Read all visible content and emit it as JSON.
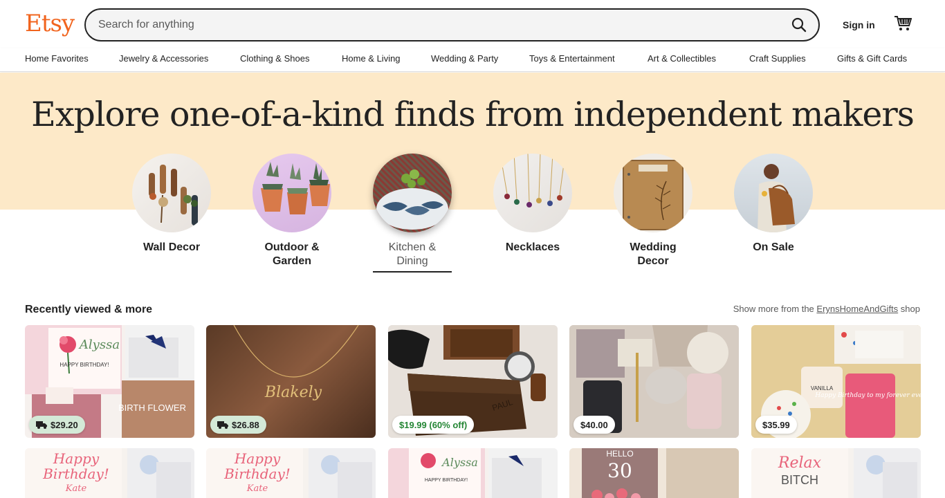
{
  "header": {
    "logo": "Etsy",
    "search_placeholder": "Search for anything",
    "sign_in": "Sign in"
  },
  "nav": {
    "items": [
      "Home Favorites",
      "Jewelry & Accessories",
      "Clothing & Shoes",
      "Home & Living",
      "Wedding & Party",
      "Toys & Entertainment",
      "Art & Collectibles",
      "Craft Supplies",
      "Gifts & Gift Cards"
    ]
  },
  "hero": {
    "title": "Explore one-of-a-kind finds from independent makers"
  },
  "categories": [
    {
      "line1": "Wall Decor",
      "line2": ""
    },
    {
      "line1": "Outdoor &",
      "line2": "Garden"
    },
    {
      "line1": "Kitchen &",
      "line2": "Dining"
    },
    {
      "line1": "Necklaces",
      "line2": ""
    },
    {
      "line1": "Wedding",
      "line2": "Decor"
    },
    {
      "line1": "On Sale",
      "line2": ""
    }
  ],
  "recent": {
    "title": "Recently viewed & more",
    "shop_prefix": "Show more from the",
    "shop_name": "ErynsHomeAndGifts",
    "shop_suffix": "shop",
    "items": [
      {
        "price": "$29.20",
        "free_shipping": true,
        "sale": false
      },
      {
        "price": "$26.88",
        "free_shipping": true,
        "sale": false
      },
      {
        "price": "$19.99 (60% off)",
        "free_shipping": false,
        "sale": true
      },
      {
        "price": "$40.00",
        "free_shipping": false,
        "sale": false
      },
      {
        "price": "$35.99",
        "free_shipping": false,
        "sale": false
      }
    ]
  },
  "image_text": {
    "card1_name": "Alyssa",
    "card1_birthday": "HAPPY BIRTHDAY!",
    "card1_box": "BIRTH FLOWER",
    "card2_name": "Blakely",
    "card3_name": "PAUL",
    "card5_jar": "VANILLA",
    "card5_candle": "Happy Birthday to my forever ever",
    "row2_happy": "Happy",
    "row2_birthday": "Birthday!",
    "row2_name": "Kate",
    "row2_hello": "HELLO",
    "row2_thirty": "30",
    "row2_relax": "Relax",
    "row2_bitch": "BITCH"
  },
  "colors": {
    "brand": "#f1641e",
    "hero_bg": "#fde9c8",
    "shipping_badge": "#d4e9d7",
    "sale_text": "#258635"
  }
}
